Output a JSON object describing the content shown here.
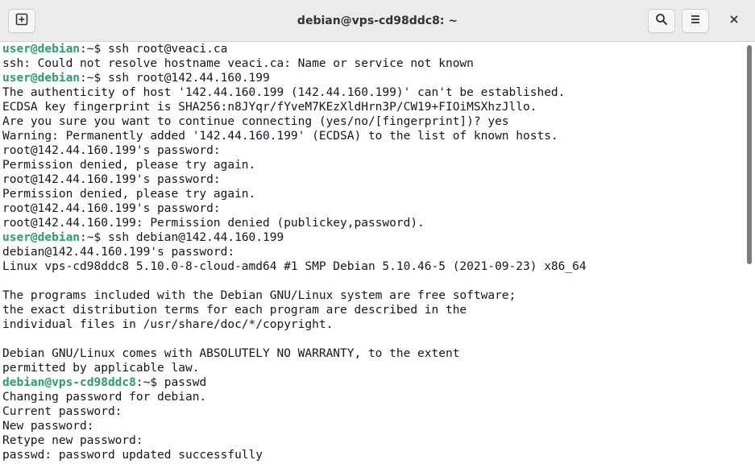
{
  "window": {
    "title": "debian@vps-cd98ddc8: ~"
  },
  "titlebar": {
    "icons": {
      "new_tab": "new-tab-icon",
      "search": "search-icon",
      "menu": "hamburger-menu-icon",
      "close": "close-icon"
    }
  },
  "colors": {
    "prompt": "#26a269",
    "text": "#171421",
    "titlebar": "#ebebeb"
  },
  "terminal": {
    "lines": [
      {
        "type": "prompt",
        "user": "user@debian",
        "rest": ":~$ ssh root@veaci.ca"
      },
      {
        "type": "text",
        "text": "ssh: Could not resolve hostname veaci.ca: Name or service not known"
      },
      {
        "type": "prompt",
        "user": "user@debian",
        "rest": ":~$ ssh root@142.44.160.199"
      },
      {
        "type": "text",
        "text": "The authenticity of host '142.44.160.199 (142.44.160.199)' can't be established."
      },
      {
        "type": "text",
        "text": "ECDSA key fingerprint is SHA256:n8JYqr/fYveM7KEzXldHrn3P/CW19+FIOiMSXhzJllo."
      },
      {
        "type": "text",
        "text": "Are you sure you want to continue connecting (yes/no/[fingerprint])? yes"
      },
      {
        "type": "text",
        "text": "Warning: Permanently added '142.44.160.199' (ECDSA) to the list of known hosts."
      },
      {
        "type": "text",
        "text": "root@142.44.160.199's password:"
      },
      {
        "type": "text",
        "text": "Permission denied, please try again."
      },
      {
        "type": "text",
        "text": "root@142.44.160.199's password:"
      },
      {
        "type": "text",
        "text": "Permission denied, please try again."
      },
      {
        "type": "text",
        "text": "root@142.44.160.199's password:"
      },
      {
        "type": "text",
        "text": "root@142.44.160.199: Permission denied (publickey,password)."
      },
      {
        "type": "prompt",
        "user": "user@debian",
        "rest": ":~$ ssh debian@142.44.160.199"
      },
      {
        "type": "text",
        "text": "debian@142.44.160.199's password:"
      },
      {
        "type": "text",
        "text": "Linux vps-cd98ddc8 5.10.0-8-cloud-amd64 #1 SMP Debian 5.10.46-5 (2021-09-23) x86_64"
      },
      {
        "type": "text",
        "text": ""
      },
      {
        "type": "text",
        "text": "The programs included with the Debian GNU/Linux system are free software;"
      },
      {
        "type": "text",
        "text": "the exact distribution terms for each program are described in the"
      },
      {
        "type": "text",
        "text": "individual files in /usr/share/doc/*/copyright."
      },
      {
        "type": "text",
        "text": ""
      },
      {
        "type": "text",
        "text": "Debian GNU/Linux comes with ABSOLUTELY NO WARRANTY, to the extent"
      },
      {
        "type": "text",
        "text": "permitted by applicable law."
      },
      {
        "type": "prompt",
        "user": "debian@vps-cd98ddc8",
        "rest": ":~$ passwd"
      },
      {
        "type": "text",
        "text": "Changing password for debian."
      },
      {
        "type": "text",
        "text": "Current password:"
      },
      {
        "type": "text",
        "text": "New password:"
      },
      {
        "type": "text",
        "text": "Retype new password:"
      },
      {
        "type": "text",
        "text": "passwd: password updated successfully"
      }
    ]
  }
}
